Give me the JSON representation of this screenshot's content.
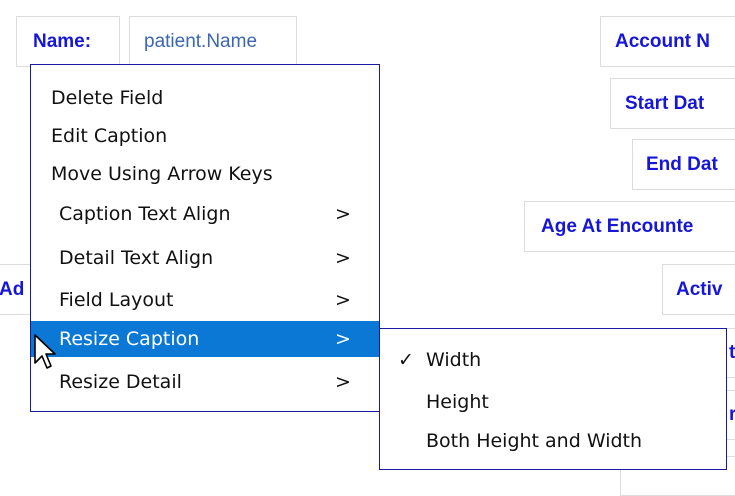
{
  "fields": {
    "name_caption": "Name:",
    "name_detail": "patient.Name",
    "account_caption": "Account N",
    "start_caption": "Start Dat",
    "end_caption": "End Dat",
    "age_caption": "Age At Encounte",
    "active_caption": "Activ",
    "left_partial": "Ad",
    "partial_r1": "t",
    "partial_r2": "r"
  },
  "context_menu": {
    "items": [
      {
        "label": "Delete Field",
        "arrow": ""
      },
      {
        "label": "Edit Caption",
        "arrow": ""
      },
      {
        "label": "Move Using Arrow Keys",
        "arrow": ""
      },
      {
        "label": "Caption Text Align",
        "arrow": ">"
      },
      {
        "label": "Detail Text Align",
        "arrow": ">"
      },
      {
        "label": "Field Layout",
        "arrow": ">"
      },
      {
        "label": "Resize Caption",
        "arrow": ">"
      },
      {
        "label": "Resize Detail",
        "arrow": ">"
      }
    ],
    "active_index": 6
  },
  "submenu": {
    "items": [
      {
        "label": "Width",
        "checked": true
      },
      {
        "label": "Height",
        "checked": false
      },
      {
        "label": "Both Height and Width",
        "checked": false
      }
    ],
    "check_mark": "✓"
  },
  "colors": {
    "caption": "#1616d8",
    "detail": "#3a66b3",
    "menu_highlight": "#0a78d4",
    "menu_border": "#1a1aa0"
  }
}
